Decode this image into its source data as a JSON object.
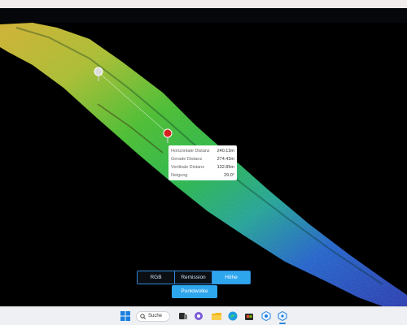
{
  "window": {
    "title": ""
  },
  "tooltip": {
    "rows": [
      {
        "label": "Horizontale Distanz",
        "value": "240.13m"
      },
      {
        "label": "Gerade Distanz",
        "value": "274.43m"
      },
      {
        "label": "Vertikale Distanz",
        "value": "132.85m"
      },
      {
        "label": "Neigung",
        "value": "29.0°"
      }
    ]
  },
  "modes": {
    "items": [
      "RGB",
      "Remission",
      "Höhe"
    ],
    "active": "Höhe"
  },
  "pointcloud_button": {
    "label": "Punktwolke"
  },
  "taskbar": {
    "search_label": "Suche",
    "icons": [
      "windows-start-icon",
      "search-icon",
      "task-view-icon",
      "chat-icon",
      "file-explorer-icon",
      "edge-browser-icon",
      "store-icon",
      "app-icon",
      "active-app-icon"
    ]
  },
  "colors": {
    "accent": "#2ea6ee",
    "background": "#000000",
    "start_marker": "#dcdcdc",
    "end_marker": "#d42020"
  }
}
